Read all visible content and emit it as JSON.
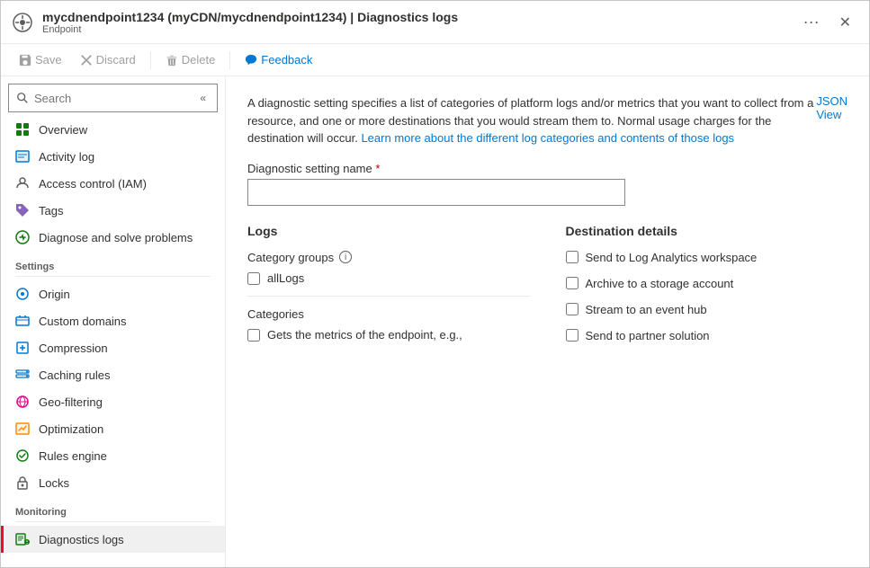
{
  "window": {
    "title": "mycdnendpoint1234 (myCDN/mycdnendpoint1234) | Diagnostics logs",
    "subtitle": "Endpoint",
    "dots_label": "···",
    "close_label": "✕"
  },
  "toolbar": {
    "save_label": "Save",
    "discard_label": "Discard",
    "delete_label": "Delete",
    "feedback_label": "Feedback"
  },
  "sidebar": {
    "search_placeholder": "Search",
    "nav_items": [
      {
        "id": "overview",
        "label": "Overview",
        "icon": "grid"
      },
      {
        "id": "activity-log",
        "label": "Activity log",
        "icon": "list"
      },
      {
        "id": "access-control",
        "label": "Access control (IAM)",
        "icon": "person"
      },
      {
        "id": "tags",
        "label": "Tags",
        "icon": "tag"
      },
      {
        "id": "diagnose",
        "label": "Diagnose and solve problems",
        "icon": "stethoscope"
      }
    ],
    "sections": [
      {
        "title": "Settings",
        "items": [
          {
            "id": "origin",
            "label": "Origin",
            "icon": "origin"
          },
          {
            "id": "custom-domains",
            "label": "Custom domains",
            "icon": "domain"
          },
          {
            "id": "compression",
            "label": "Compression",
            "icon": "compress"
          },
          {
            "id": "caching-rules",
            "label": "Caching rules",
            "icon": "caching"
          },
          {
            "id": "geo-filtering",
            "label": "Geo-filtering",
            "icon": "geo"
          },
          {
            "id": "optimization",
            "label": "Optimization",
            "icon": "optimization"
          },
          {
            "id": "rules-engine",
            "label": "Rules engine",
            "icon": "rules"
          },
          {
            "id": "locks",
            "label": "Locks",
            "icon": "lock"
          }
        ]
      },
      {
        "title": "Monitoring",
        "items": [
          {
            "id": "diagnostics-logs",
            "label": "Diagnostics logs",
            "icon": "diag",
            "active": true
          }
        ]
      }
    ]
  },
  "content": {
    "description": "A diagnostic setting specifies a list of categories of platform logs and/or metrics that you want to collect from a resource, and one or more destinations that you would stream them to. Normal usage charges for the destination will occur. Learn more about the different log categories and contents of those logs",
    "description_plain": "A diagnostic setting specifies a list of categories of platform logs and/or metrics that you want to collect from a resource, and one or more destinations that you would stream them to. Normal usage charges for the destination will occur. ",
    "description_link_text": "Learn more about the different log categories and contents of those logs",
    "json_view_label": "JSON View",
    "diagnostic_name_label": "Diagnostic setting name",
    "required_indicator": "*",
    "diagnostic_name_value": "",
    "logs_title": "Logs",
    "category_groups_label": "Category groups",
    "all_logs_label": "allLogs",
    "categories_label": "Categories",
    "metrics_label": "Gets the metrics of the endpoint, e.g.,",
    "destination_title": "Destination details",
    "destinations": [
      {
        "id": "log-analytics",
        "label": "Send to Log Analytics workspace"
      },
      {
        "id": "storage-account",
        "label": "Archive to a storage account"
      },
      {
        "id": "event-hub",
        "label": "Stream to an event hub"
      },
      {
        "id": "partner-solution",
        "label": "Send to partner solution"
      }
    ]
  }
}
